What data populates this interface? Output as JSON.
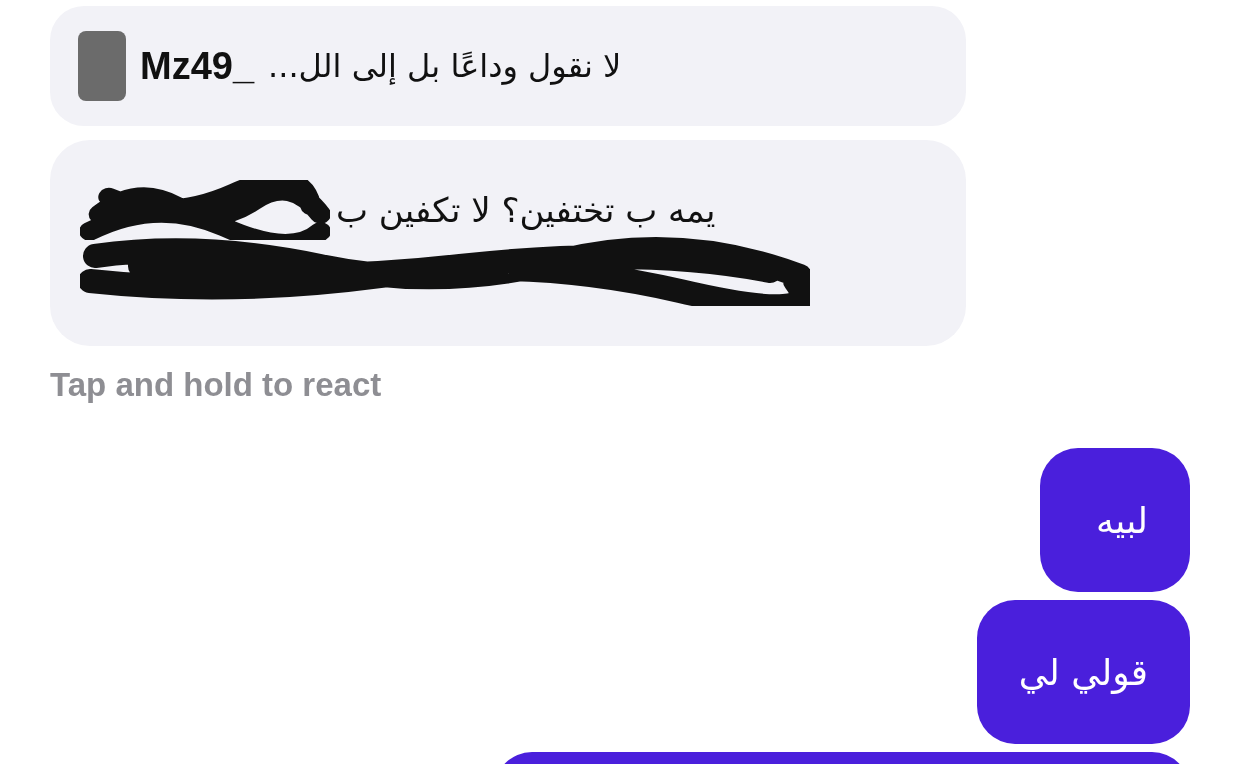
{
  "reply_quote": {
    "name": "Mz49_",
    "text": "لا نقول وداعًا بل إلى الل..."
  },
  "incoming_message": {
    "text": "يمه ب تختفين؟ لا تكفين ب",
    "redacted": true
  },
  "hint": "Tap and hold to react",
  "outgoing_messages": [
    {
      "text": "لبيه"
    },
    {
      "text": "قولي لي"
    }
  ]
}
